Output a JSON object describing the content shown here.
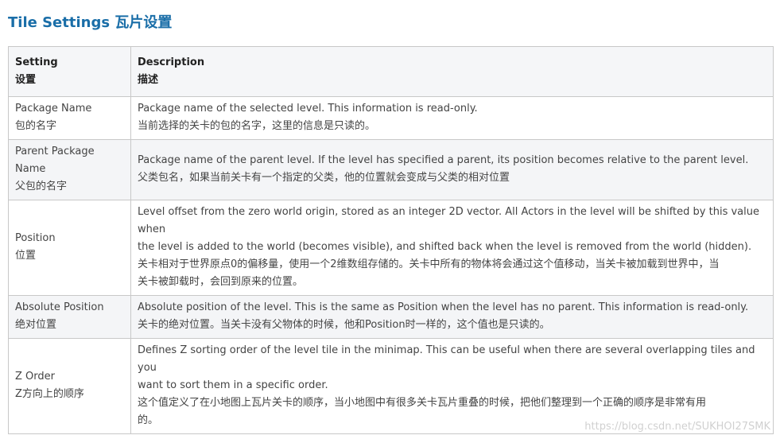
{
  "heading": "Tile Settings  瓦片设置",
  "table": {
    "headers": [
      [
        "Setting",
        "设置"
      ],
      [
        "Description",
        "描述"
      ]
    ],
    "rows": [
      {
        "setting": [
          "Package Name",
          "包的名字"
        ],
        "description": [
          "Package name of the selected level. This information is read-only.",
          "当前选择的关卡的包的名字，这里的信息是只读的。"
        ]
      },
      {
        "setting": [
          "Parent Package",
          "Name",
          "父包的名字"
        ],
        "description": [
          "Package name of the parent level. If the level has specified a parent, its position becomes relative to the parent level.",
          "父类包名，如果当前关卡有一个指定的父类，他的位置就会变成与父类的相对位置"
        ]
      },
      {
        "setting": [
          "Position",
          "位置"
        ],
        "description": [
          "Level offset from the zero world origin, stored as an integer 2D vector. All Actors in the level will be shifted by this value when",
          "the level is added to the world (becomes visible), and shifted back when the level is removed from the world (hidden).",
          "关卡相对于世界原点0的偏移量，使用一个2维数组存储的。关卡中所有的物体将会通过这个值移动，当关卡被加载到世界中，当",
          "关卡被卸载时，会回到原来的位置。"
        ]
      },
      {
        "setting": [
          "Absolute Position",
          "绝对位置"
        ],
        "description": [
          "Absolute position of the level. This is the same as Position when the level has no parent. This information is read-only.",
          "关卡的绝对位置。当关卡没有父物体的时候，他和Position时一样的，这个值也是只读的。"
        ]
      },
      {
        "setting": [
          "Z Order",
          "Z方向上的顺序"
        ],
        "description": [
          "Defines Z sorting order of the level tile in the minimap. This can be useful when there are several overlapping tiles and you",
          "want to sort them in a specific order.",
          "这个值定义了在小地图上瓦片关卡的顺序，当小地图中有很多关卡瓦片重叠的时候，把他们整理到一个正确的顺序是非常有用",
          "的。"
        ]
      }
    ]
  },
  "watermark": "https://blog.csdn.net/SUKHOI27SMK"
}
